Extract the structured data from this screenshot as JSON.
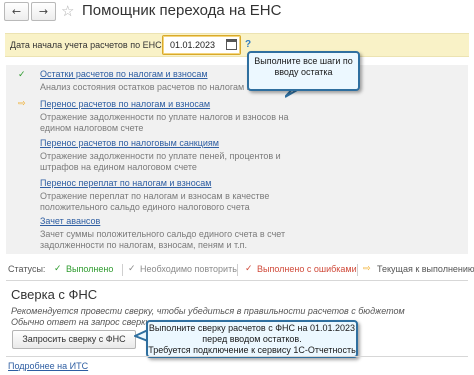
{
  "window": {
    "title": "Помощник перехода на ЕНС",
    "back_icon": "arrow-left",
    "forward_icon": "arrow-right",
    "favorite_icon": "star"
  },
  "date_bar": {
    "label": "Дата начала учета расчетов по ЕНС:",
    "value": "01.01.2023",
    "help": "?"
  },
  "steps": [
    {
      "status": "done",
      "icon": "check",
      "link": "Остатки расчетов по налогам и взносам",
      "desc": [
        "Анализ состояния остатков расчетов по налогам и взносам"
      ]
    },
    {
      "status": "current",
      "icon": "arrow-right",
      "link": "Перенос расчетов по налогам и взносам",
      "desc": [
        "Отражение задолженности по уплате налогов и взносов на",
        "едином налоговом счете"
      ]
    },
    {
      "status": "pending",
      "icon": "",
      "link": "Перенос расчетов по налоговым санкциям",
      "desc": [
        "Отражение задолженности по уплате пеней, процентов и",
        "штрафов на едином налоговом счете"
      ]
    },
    {
      "status": "pending",
      "icon": "",
      "link": "Перенос переплат по налогам и взносам",
      "desc": [
        "Отражение переплат по налогам и взносам в качестве",
        "положительного сальдо единого налогового счета"
      ]
    },
    {
      "status": "pending",
      "icon": "",
      "link": "Зачет авансов",
      "desc": [
        "Зачет суммы положительного сальдо единого счета в счет",
        "задолженности по налогам, взносам, пеням и т.п."
      ]
    }
  ],
  "tooltip_top": {
    "lines": [
      "Выполните все шаги по",
      "вводу остатка"
    ]
  },
  "statuses": {
    "label": "Статусы:",
    "items": [
      {
        "icon": "check",
        "text": "Выполнено",
        "color": "#2e9b2e"
      },
      {
        "icon": "check",
        "text": "Необходимо повторить",
        "color": "#8a8a8a"
      },
      {
        "icon": "check",
        "text": "Выполнено с ошибками",
        "color": "#d04a3a"
      },
      {
        "icon": "arrow-right",
        "text": "Текущая к выполнению",
        "color": "#f0a81c"
      }
    ]
  },
  "reconciliation": {
    "title": "Сверка с ФНС",
    "line1": "Рекомендуется провести сверку, чтобы убедиться в правильности расчетов с бюджетом",
    "line2": "Обычно ответ на запрос сверки",
    "button": "Запросить сверку с ФНС",
    "tooltip": [
      "Выполните сверку расчетов с ФНС на 01.01.2023",
      "перед вводом остатков.",
      "Требуется подключение к сервису 1С-Отчетность"
    ]
  },
  "its_link": "Подробнее на ИТС",
  "colors": {
    "link": "#2e5ea2",
    "date_bar": "#f9f2c7",
    "tooltip_border": "#2f6f9f",
    "current_arrow": "#f0a81c"
  }
}
